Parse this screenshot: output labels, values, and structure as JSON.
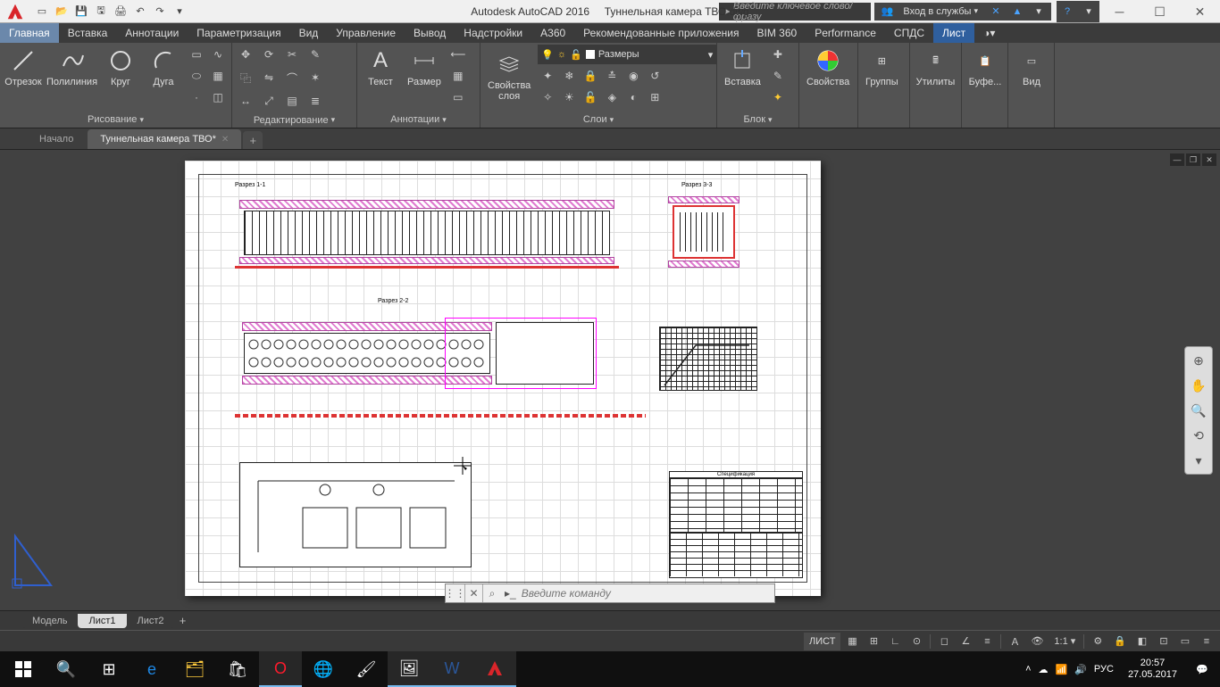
{
  "title": {
    "app": "Autodesk AutoCAD 2016",
    "doc": "Туннельная камера ТВО.dwg"
  },
  "search_placeholder": "Введите ключевое слово/фразу",
  "signin": "Вход в службы",
  "menubar": [
    "Главная",
    "Вставка",
    "Аннотации",
    "Параметризация",
    "Вид",
    "Управление",
    "Вывод",
    "Надстройки",
    "A360",
    "Рекомендованные приложения",
    "BIM 360",
    "Performance",
    "СПДС",
    "Лист"
  ],
  "ribbon": {
    "draw": {
      "title": "Рисование",
      "btns": {
        "line": "Отрезок",
        "pline": "Полилиния",
        "circle": "Круг",
        "arc": "Дуга"
      }
    },
    "modify": {
      "title": "Редактирование"
    },
    "annot": {
      "title": "Аннотации",
      "btns": {
        "text": "Текст",
        "dim": "Размер"
      }
    },
    "layers": {
      "title": "Слои",
      "btns": {
        "props": "Свойства слоя"
      },
      "combo": "Размеры"
    },
    "block": {
      "title": "Блок",
      "btns": {
        "insert": "Вставка"
      }
    },
    "props": {
      "title": "",
      "btns": {
        "props": "Свойства"
      }
    },
    "groups": {
      "title": "",
      "btns": {
        "grp": "Группы"
      }
    },
    "util": {
      "title": "",
      "btns": {
        "ut": "Утилиты"
      }
    },
    "clip": {
      "title": "",
      "btns": {
        "cb": "Буфе..."
      }
    },
    "view": {
      "title": "",
      "btns": {
        "vw": "Вид"
      }
    }
  },
  "filetabs": {
    "start": "Начало",
    "doc": "Туннельная камера ТВО*"
  },
  "layouttabs": {
    "model": "Модель",
    "l1": "Лист1",
    "l2": "Лист2"
  },
  "cmdline_placeholder": "Введите команду",
  "status": {
    "layout": "ЛИСТ"
  },
  "tray": {
    "lang": "РУС",
    "time": "20:57",
    "date": "27.05.2017"
  },
  "drawing": {
    "sec1": "Разрез 1-1",
    "sec2": "Разрез 2-2",
    "sec3": "Разрез 3-3",
    "spec": "Спецификация"
  }
}
